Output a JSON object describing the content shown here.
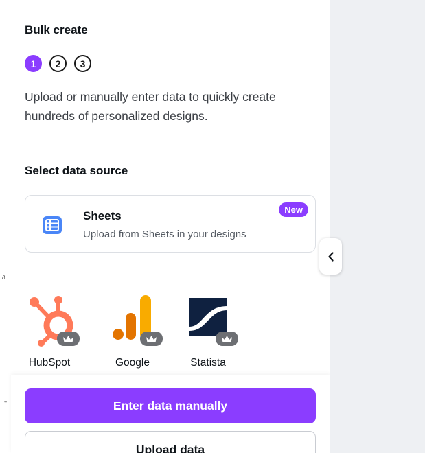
{
  "panel": {
    "title": "Bulk create",
    "steps": [
      {
        "label": "1",
        "active": true
      },
      {
        "label": "2",
        "active": false
      },
      {
        "label": "3",
        "active": false
      }
    ],
    "description": "Upload or manually enter data to quickly create hundreds of personalized designs.",
    "section_title": "Select data source"
  },
  "sheets_card": {
    "icon": "table-grid-icon",
    "title": "Sheets",
    "subtitle": "Upload from Sheets in your designs",
    "badge": "New"
  },
  "apps": [
    {
      "label": "HubSpot",
      "icon": "hubspot-icon",
      "premium": true
    },
    {
      "label": "Google",
      "icon": "google-analytics-icon",
      "premium": true
    },
    {
      "label": "Statista",
      "icon": "statista-icon",
      "premium": true
    }
  ],
  "stray_text": {
    "a": "a",
    "b": "\""
  },
  "buttons": {
    "enter_manually": "Enter data manually",
    "upload": "Upload data"
  },
  "colors": {
    "accent": "#8b3dff",
    "hubspot": "#ff7a59",
    "google_orange": "#f9ab00",
    "google_dark_orange": "#e37400",
    "statista_navy": "#0f2140",
    "sheets_blue": "#4a86f7"
  }
}
